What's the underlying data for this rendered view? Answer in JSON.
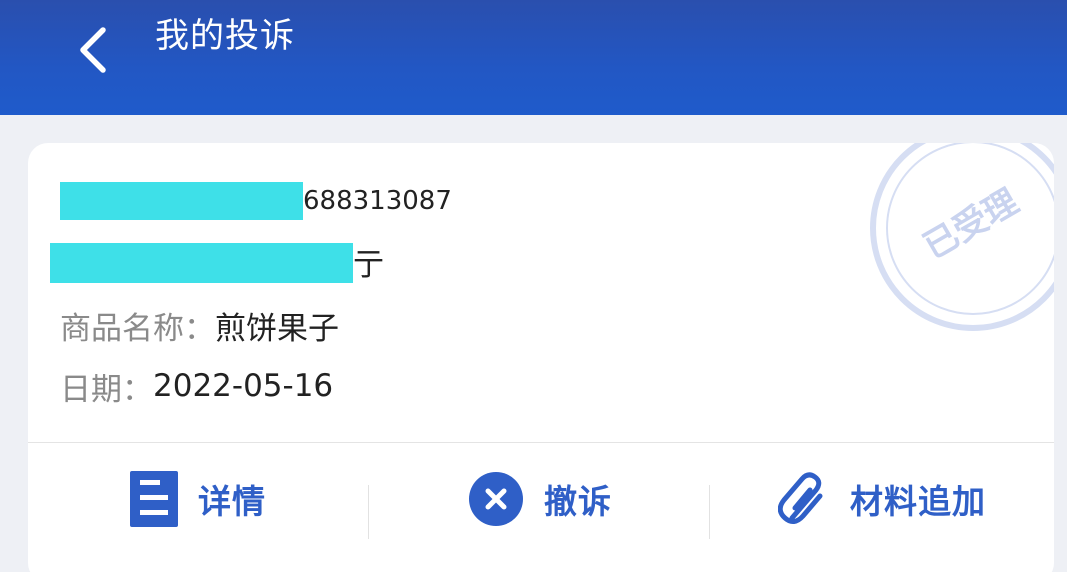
{
  "header": {
    "title": "我的投诉",
    "back_icon": "chevron-left-icon"
  },
  "complaint": {
    "id_suffix": "688313087",
    "merchant_suffix": "亍",
    "product_label": "商品名称：",
    "product_value": "煎饼果子",
    "date_label": "日期：",
    "date_value": "2022-05-16",
    "stamp_text": "已受理"
  },
  "actions": {
    "detail": "详情",
    "withdraw": "撤诉",
    "material": "材料追加"
  },
  "colors": {
    "header": "#2257c4",
    "accent": "#2f5fc7",
    "redaction": "#3ee0e8",
    "stamp": "#c9d3ef"
  }
}
